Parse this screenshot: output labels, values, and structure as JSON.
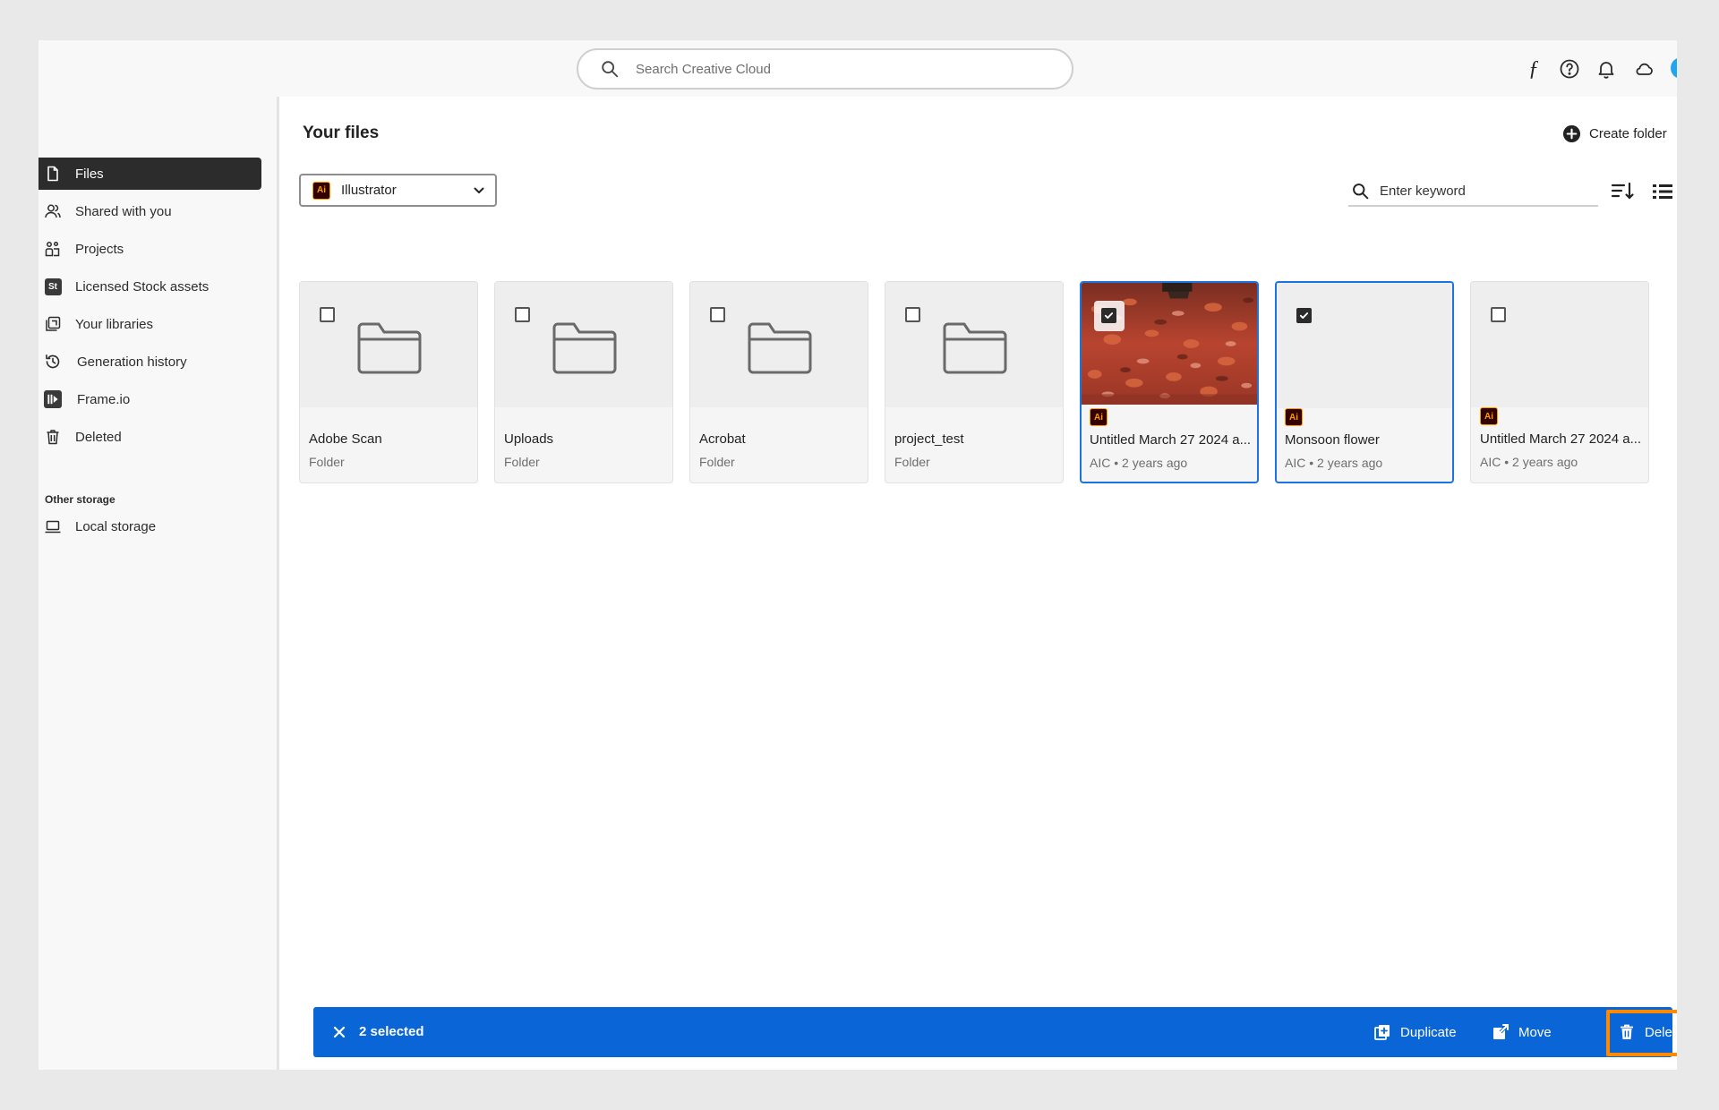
{
  "search": {
    "placeholder": "Search Creative Cloud"
  },
  "topbar": {
    "icons": [
      "fonts-icon",
      "help-icon",
      "bell-icon",
      "cloud-icon"
    ],
    "avatar_color": "#1fa6ee"
  },
  "sidebar": {
    "items": [
      {
        "label": "Files",
        "icon": "file-icon",
        "active": true
      },
      {
        "label": "Shared with you",
        "icon": "shared-users-icon"
      },
      {
        "label": "Projects",
        "icon": "projects-icon"
      },
      {
        "label": "Licensed Stock assets",
        "icon": "stock-icon",
        "badge": "St"
      },
      {
        "label": "Your libraries",
        "icon": "libraries-icon"
      },
      {
        "label": "Generation history",
        "icon": "history-icon"
      },
      {
        "label": "Frame.io",
        "icon": "frameio-icon"
      },
      {
        "label": "Deleted",
        "icon": "trash-icon"
      }
    ],
    "other_storage": {
      "heading": "Other storage",
      "items": [
        {
          "label": "Local storage",
          "icon": "laptop-icon"
        }
      ]
    }
  },
  "main": {
    "title": "Your files",
    "create_folder_label": "Create folder",
    "filter": {
      "selected": "Illustrator",
      "badge": "Ai"
    },
    "keyword_placeholder": "Enter keyword",
    "files": [
      {
        "name": "Adobe Scan",
        "meta": "Folder",
        "kind": "folder",
        "selected": false
      },
      {
        "name": "Uploads",
        "meta": "Folder",
        "kind": "folder",
        "selected": false
      },
      {
        "name": "Acrobat",
        "meta": "Folder",
        "kind": "folder",
        "selected": false
      },
      {
        "name": "project_test",
        "meta": "Folder",
        "kind": "folder",
        "selected": false
      },
      {
        "name": "Untitled March 27 2024 a...",
        "meta": "AIC • 2 years ago",
        "kind": "ai-photo",
        "badge": "Ai",
        "selected": true
      },
      {
        "name": "Monsoon flower",
        "meta": "AIC • 2 years ago",
        "kind": "ai",
        "badge": "Ai",
        "selected": true
      },
      {
        "name": "Untitled March 27 2024 a...",
        "meta": "AIC • 2 years ago",
        "kind": "ai",
        "badge": "Ai",
        "selected": false
      }
    ]
  },
  "selection_bar": {
    "count_label": "2 selected",
    "actions": [
      {
        "label": "Duplicate",
        "icon": "duplicate-icon"
      },
      {
        "label": "Move",
        "icon": "move-icon"
      },
      {
        "label": "Delete",
        "icon": "trash-icon",
        "highlighted": true
      }
    ],
    "color": "#0a66d6",
    "highlight_color": "#ff8a00"
  },
  "colors": {
    "selected_border": "#1d74e0",
    "illustrator_badge": "#ff9a00"
  }
}
